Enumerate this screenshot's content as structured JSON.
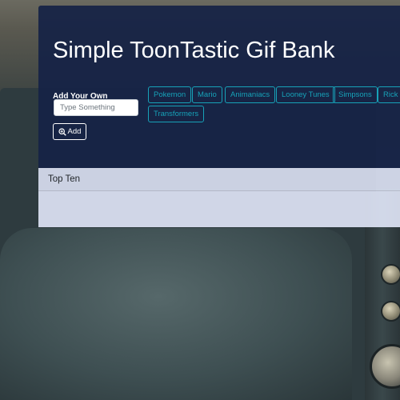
{
  "header": {
    "title": "Simple ToonTastic Gif Bank"
  },
  "add_form": {
    "label": "Add Your Own",
    "input_placeholder": "Type Something",
    "input_value": "",
    "button_label": "Add",
    "button_icon": "search-plus-icon"
  },
  "topics": [
    "Pokemon",
    "Mario",
    "Animaniacs",
    "Looney Tunes",
    "Simpsons",
    "Rick",
    "Transformers"
  ],
  "top_ten": {
    "header": "Top Ten"
  },
  "colors": {
    "jumbotron_bg": "#162246",
    "topic_accent": "#17a2b8",
    "card_bg": "#e2e8fa"
  }
}
